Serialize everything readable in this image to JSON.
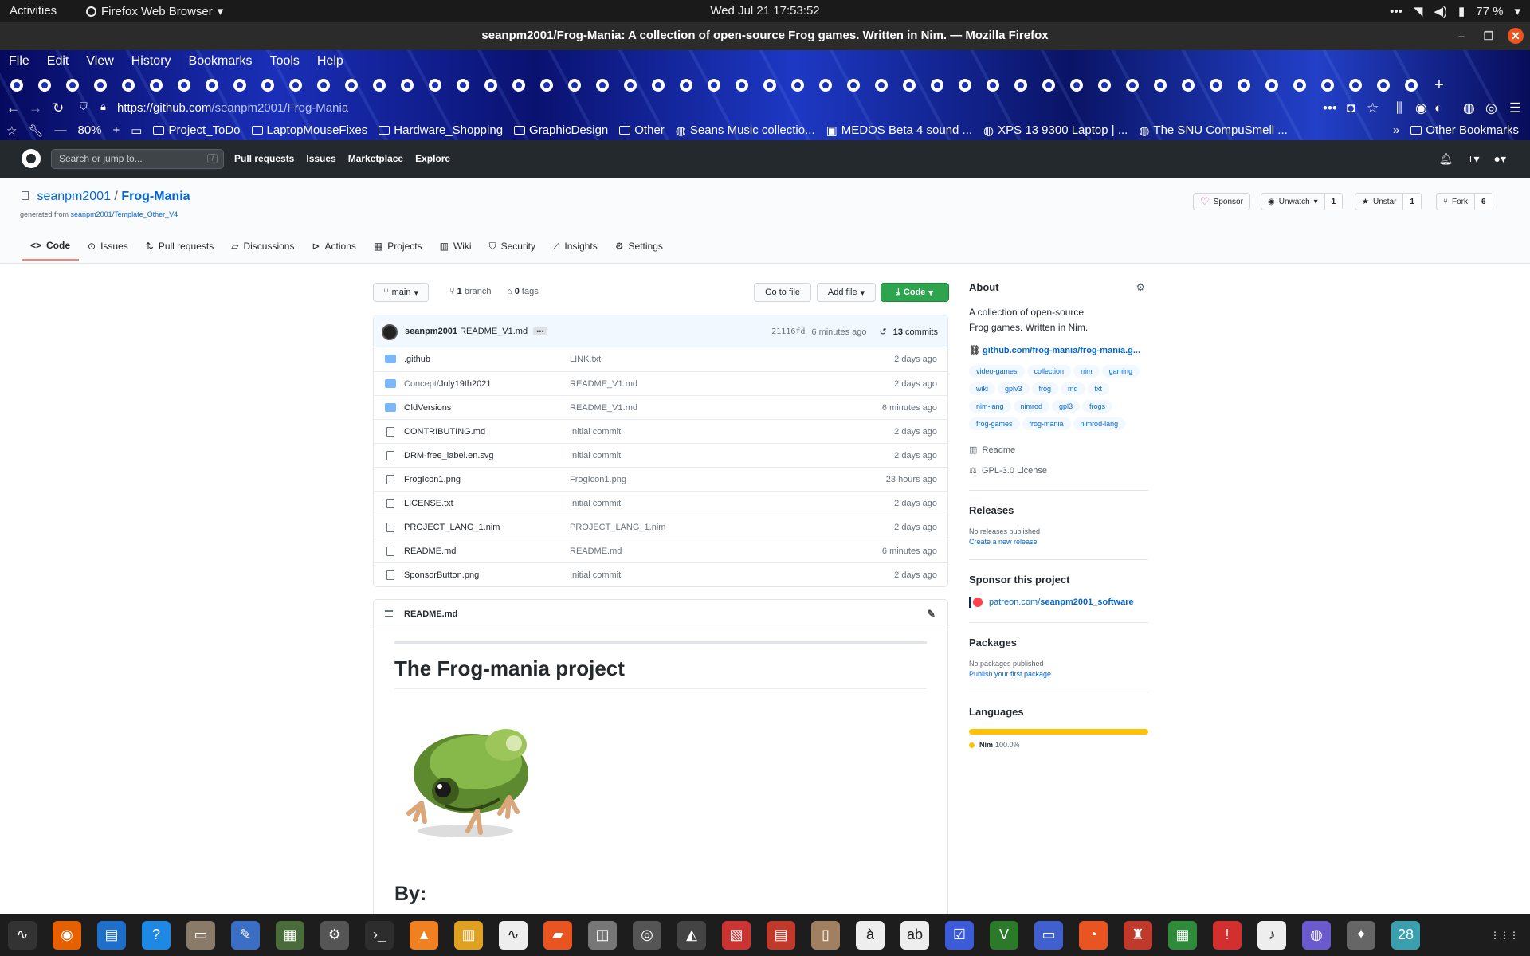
{
  "topbar": {
    "activities": "Activities",
    "app_name": "Firefox Web Browser",
    "clock": "Wed Jul 21  17:53:52",
    "battery": "77 %"
  },
  "window": {
    "title": "seanpm2001/Frog-Mania: A collection of open-source Frog games. Written in Nim. — Mozilla Firefox"
  },
  "menubar": [
    "File",
    "Edit",
    "View",
    "History",
    "Bookmarks",
    "Tools",
    "Help"
  ],
  "navbar": {
    "url_host": "https://github.com",
    "url_path": "/seanpm2001/Frog-Mania",
    "zoom": "80%"
  },
  "bookmarks": [
    {
      "label": "Project_ToDo",
      "icon": "folder-icon"
    },
    {
      "label": "LaptopMouseFixes",
      "icon": "folder-icon"
    },
    {
      "label": "Hardware_Shopping",
      "icon": "folder-icon"
    },
    {
      "label": "GraphicDesign",
      "icon": "folder-icon"
    },
    {
      "label": "Other",
      "icon": "folder-icon"
    },
    {
      "label": "Seans Music collectio...",
      "icon": "globe-icon"
    },
    {
      "label": "MEDOS Beta 4 sound ...",
      "icon": "page-icon"
    },
    {
      "label": "XPS 13 9300 Laptop | ...",
      "icon": "globe-icon"
    },
    {
      "label": "The SNU CompuSmell ...",
      "icon": "globe-icon"
    }
  ],
  "bookmarks_other": "Other Bookmarks",
  "gh": {
    "search_placeholder": "Search or jump to...",
    "search_key": "/",
    "nav": [
      "Pull requests",
      "Issues",
      "Marketplace",
      "Explore"
    ]
  },
  "repo": {
    "owner": "seanpm2001",
    "sep": "/",
    "name": "Frog-Mania",
    "generated_prefix": "generated from ",
    "generated_link": "seanpm2001/Template_Other_V4",
    "sponsor": "Sponsor",
    "watch": "Unwatch",
    "watch_count": "1",
    "star": "Unstar",
    "star_count": "1",
    "fork": "Fork",
    "fork_count": "6"
  },
  "tabs": [
    "Code",
    "Issues",
    "Pull requests",
    "Discussions",
    "Actions",
    "Projects",
    "Wiki",
    "Security",
    "Insights",
    "Settings"
  ],
  "toolbar": {
    "branch": "main",
    "branches_count": "1",
    "branches_label": "branch",
    "tags_count": "0",
    "tags_label": "tags",
    "go_to_file": "Go to file",
    "add_file": "Add file",
    "code": "Code"
  },
  "last_commit": {
    "author": "seanpm2001",
    "message": "README_V1.md",
    "sha": "21116fd",
    "time": "6 minutes ago",
    "commits_count": "13",
    "commits_label": "commits"
  },
  "files": [
    {
      "name": "",
      "name_main": ".github",
      "type": "dir",
      "commit": "LINK.txt",
      "time": "2 days ago"
    },
    {
      "name": "Concept/",
      "name_main": "July19th2021",
      "type": "dir",
      "commit": "README_V1.md",
      "time": "2 days ago"
    },
    {
      "name": "",
      "name_main": "OldVersions",
      "type": "dir",
      "commit": "README_V1.md",
      "time": "6 minutes ago"
    },
    {
      "name": "",
      "name_main": "CONTRIBUTING.md",
      "type": "file",
      "commit": "Initial commit",
      "time": "2 days ago"
    },
    {
      "name": "",
      "name_main": "DRM-free_label.en.svg",
      "type": "file",
      "commit": "Initial commit",
      "time": "2 days ago"
    },
    {
      "name": "",
      "name_main": "FrogIcon1.png",
      "type": "file",
      "commit": "FrogIcon1.png",
      "time": "23 hours ago"
    },
    {
      "name": "",
      "name_main": "LICENSE.txt",
      "type": "file",
      "commit": "Initial commit",
      "time": "2 days ago"
    },
    {
      "name": "",
      "name_main": "PROJECT_LANG_1.nim",
      "type": "file",
      "commit": "PROJECT_LANG_1.nim",
      "time": "2 days ago"
    },
    {
      "name": "",
      "name_main": "README.md",
      "type": "file",
      "commit": "README.md",
      "time": "6 minutes ago"
    },
    {
      "name": "",
      "name_main": "SponsorButton.png",
      "type": "file",
      "commit": "Initial commit",
      "time": "2 days ago"
    }
  ],
  "readme": {
    "filename": "README.md",
    "h1": "The Frog-mania project",
    "h2": "By:"
  },
  "about": {
    "title": "About",
    "description": "A collection of open-source Frog games. Written in Nim.",
    "link": "github.com/frog-mania/frog-mania.g...",
    "topics": [
      "video-games",
      "collection",
      "nim",
      "gaming",
      "wiki",
      "gplv3",
      "frog",
      "md",
      "txt",
      "nim-lang",
      "nimrod",
      "gpl3",
      "frogs",
      "frog-games",
      "frog-mania",
      "nimrod-lang"
    ],
    "readme": "Readme",
    "license": "GPL-3.0 License"
  },
  "releases": {
    "title": "Releases",
    "none": "No releases published",
    "create": "Create a new release"
  },
  "sponsor": {
    "title": "Sponsor this project",
    "link_prefix": "patreon.com/",
    "link_bold": "seanpm2001_software"
  },
  "packages": {
    "title": "Packages",
    "none": "No packages published",
    "publish": "Publish your first package"
  },
  "languages": {
    "title": "Languages",
    "items": [
      {
        "name": "Nim",
        "percent": "100.0%",
        "share": 1.0,
        "color": "#ffc200"
      }
    ]
  },
  "dock_badge": "28"
}
